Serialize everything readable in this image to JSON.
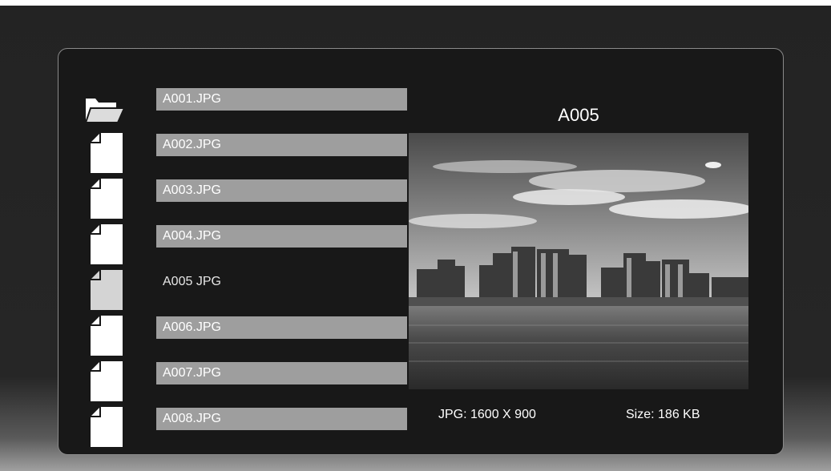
{
  "files": [
    {
      "name": "A001.JPG",
      "icon": "folder-icon",
      "selected": false
    },
    {
      "name": "A002.JPG",
      "icon": "file-icon",
      "selected": false
    },
    {
      "name": "A003.JPG",
      "icon": "file-icon",
      "selected": false
    },
    {
      "name": "A004.JPG",
      "icon": "file-icon",
      "selected": false
    },
    {
      "name": "A005 JPG",
      "icon": "file-icon",
      "selected": true
    },
    {
      "name": "A006.JPG",
      "icon": "file-icon",
      "selected": false
    },
    {
      "name": "A007.JPG",
      "icon": "file-icon",
      "selected": false
    },
    {
      "name": "A008.JPG",
      "icon": "file-icon",
      "selected": false
    }
  ],
  "preview": {
    "title": "A005",
    "resolution": "JPG: 1600 X 900",
    "size": "Size: 186 KB",
    "image_icon": "city-skyline-photo"
  },
  "colors": {
    "background": "#232323",
    "panel": "#181818",
    "label_bar": "#9e9e9e",
    "text": "#ffffff"
  }
}
